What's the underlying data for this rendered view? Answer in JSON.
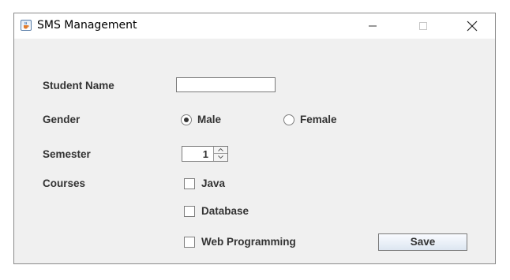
{
  "window": {
    "title": "SMS Management",
    "icon": "java-cup-icon",
    "controls": [
      "minimize-icon",
      "maximize-icon",
      "close-icon"
    ]
  },
  "form": {
    "student_name": {
      "label": "Student Name",
      "value": ""
    },
    "gender": {
      "label": "Gender",
      "options": [
        {
          "label": "Male",
          "selected": true
        },
        {
          "label": "Female",
          "selected": false
        }
      ]
    },
    "semester": {
      "label": "Semester",
      "value": "1"
    },
    "courses": {
      "label": "Courses",
      "options": [
        {
          "label": "Java",
          "checked": false
        },
        {
          "label": "Database",
          "checked": false
        },
        {
          "label": "Web Programming",
          "checked": false
        }
      ]
    },
    "save_label": "Save"
  },
  "colors": {
    "panel_bg": "#f0f0f0",
    "label_text": "#333333",
    "border": "#7a7a7a"
  }
}
